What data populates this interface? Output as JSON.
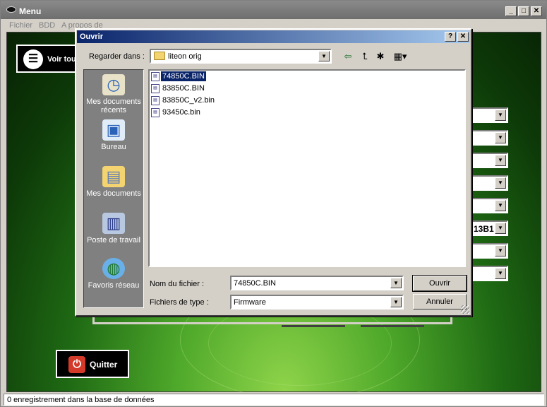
{
  "main": {
    "title": "Menu",
    "menu": [
      "Fichier",
      "BDD",
      "A propos de"
    ],
    "voir_label": "Voir tou",
    "quitter_label": "Quitter",
    "combo_values": [
      "",
      "",
      "",
      "",
      "",
      "13B1",
      "",
      ""
    ],
    "status": "0 enregistrement dans la base de données"
  },
  "dialog": {
    "title": "Ouvrir",
    "help_label": "?",
    "close_label": "✕",
    "look_in_label": "Regarder dans :",
    "look_in_value": "liteon orig",
    "places": [
      "Mes documents récents",
      "Bureau",
      "Mes documents",
      "Poste de travail",
      "Favoris réseau"
    ],
    "files": [
      "74850C.BIN",
      "83850C.BIN",
      "83850C_v2.bin",
      "93450c.bin"
    ],
    "selected_file": "74850C.BIN",
    "filename_label": "Nom du fichier :",
    "filename_value": "74850C.BIN",
    "filetype_label": "Fichiers de type :",
    "filetype_value": "Firmware",
    "open_label": "Ouvrir",
    "cancel_label": "Annuler"
  },
  "icons": {
    "back": "back-arrow-icon",
    "up": "up-folder-icon",
    "new_folder": "new-folder-icon",
    "views": "views-menu-icon"
  },
  "colors": {
    "titlebar_active": "#0a246a",
    "selection": "#0a246a",
    "background_green": "#1f6a14"
  }
}
